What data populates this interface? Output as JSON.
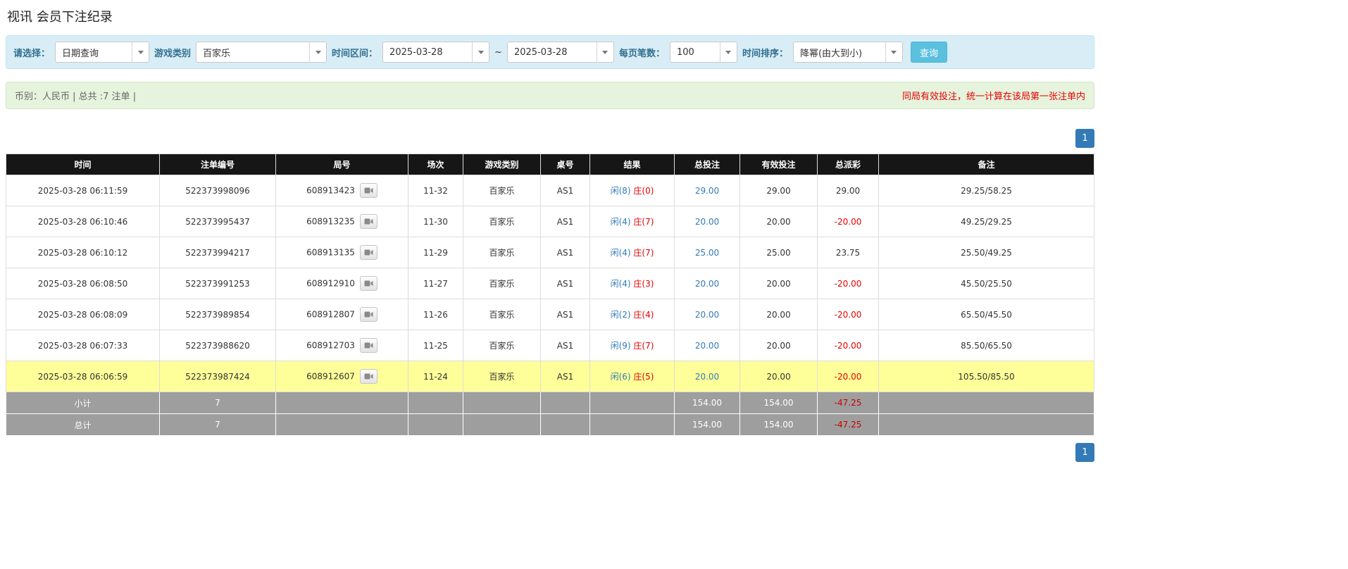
{
  "page_title": "视讯 会员下注纪录",
  "filter_bar": {
    "select_label": "请选择：",
    "select_value": "日期查询",
    "game_label": "游戏类别",
    "game_value": "百家乐",
    "range_label": "时间区间：",
    "date_from": "2025-03-28",
    "range_sep": "~",
    "date_to": "2025-03-28",
    "page_size_label": "每页笔数：",
    "page_size_value": "100",
    "sort_label": "时间排序：",
    "sort_value": "降幂(由大到小)",
    "search_label": "查询"
  },
  "notice_bar": {
    "summary": "币别：人民币 | 总共 :7 注单 |",
    "notice": "同局有效投注，统一计算在该局第一张注单内"
  },
  "pagination": {
    "current": "1"
  },
  "colors": {
    "accent_blue": "#337ab7",
    "search_button_blue": "#5bc0de",
    "negative_red": "#e60000",
    "player_blue": "#337ab7",
    "banker_red": "#e60000",
    "highlight_yellow": "#ffff99",
    "header_black": "#161616",
    "summary_gray": "#9e9e9e"
  },
  "icons": {
    "dropdown": "chevron-down-icon",
    "video": "video-replay-icon"
  },
  "table": {
    "headers": [
      "时间",
      "注单编号",
      "局号",
      "场次",
      "游戏类别",
      "桌号",
      "结果",
      "总投注",
      "有效投注",
      "总派彩",
      "备注"
    ],
    "rows": [
      {
        "time": "2025-03-28 06:11:59",
        "bet_id": "522373998096",
        "round": "608913423",
        "session": "11-32",
        "game": "百家乐",
        "table_no": "AS1",
        "result_player": "闲(8)",
        "result_banker": "庄(0)",
        "total_bet": "29.00",
        "valid_bet": "29.00",
        "payout": "29.00",
        "remark": "29.25/58.25",
        "highlight": false
      },
      {
        "time": "2025-03-28 06:10:46",
        "bet_id": "522373995437",
        "round": "608913235",
        "session": "11-30",
        "game": "百家乐",
        "table_no": "AS1",
        "result_player": "闲(4)",
        "result_banker": "庄(7)",
        "total_bet": "20.00",
        "valid_bet": "20.00",
        "payout": "-20.00",
        "remark": "49.25/29.25",
        "highlight": false
      },
      {
        "time": "2025-03-28 06:10:12",
        "bet_id": "522373994217",
        "round": "608913135",
        "session": "11-29",
        "game": "百家乐",
        "table_no": "AS1",
        "result_player": "闲(4)",
        "result_banker": "庄(7)",
        "total_bet": "25.00",
        "valid_bet": "25.00",
        "payout": "23.75",
        "remark": "25.50/49.25",
        "highlight": false
      },
      {
        "time": "2025-03-28 06:08:50",
        "bet_id": "522373991253",
        "round": "608912910",
        "session": "11-27",
        "game": "百家乐",
        "table_no": "AS1",
        "result_player": "闲(4)",
        "result_banker": "庄(3)",
        "total_bet": "20.00",
        "valid_bet": "20.00",
        "payout": "-20.00",
        "remark": "45.50/25.50",
        "highlight": false
      },
      {
        "time": "2025-03-28 06:08:09",
        "bet_id": "522373989854",
        "round": "608912807",
        "session": "11-26",
        "game": "百家乐",
        "table_no": "AS1",
        "result_player": "闲(2)",
        "result_banker": "庄(4)",
        "total_bet": "20.00",
        "valid_bet": "20.00",
        "payout": "-20.00",
        "remark": "65.50/45.50",
        "highlight": false
      },
      {
        "time": "2025-03-28 06:07:33",
        "bet_id": "522373988620",
        "round": "608912703",
        "session": "11-25",
        "game": "百家乐",
        "table_no": "AS1",
        "result_player": "闲(9)",
        "result_banker": "庄(7)",
        "total_bet": "20.00",
        "valid_bet": "20.00",
        "payout": "-20.00",
        "remark": "85.50/65.50",
        "highlight": false
      },
      {
        "time": "2025-03-28 06:06:59",
        "bet_id": "522373987424",
        "round": "608912607",
        "session": "11-24",
        "game": "百家乐",
        "table_no": "AS1",
        "result_player": "闲(6)",
        "result_banker": "庄(5)",
        "total_bet": "20.00",
        "valid_bet": "20.00",
        "payout": "-20.00",
        "remark": "105.50/85.50",
        "highlight": true
      }
    ],
    "summary_rows": [
      {
        "label": "小计",
        "count": "7",
        "total_bet": "154.00",
        "valid_bet": "154.00",
        "payout": "-47.25"
      },
      {
        "label": "总计",
        "count": "7",
        "total_bet": "154.00",
        "valid_bet": "154.00",
        "payout": "-47.25"
      }
    ]
  }
}
